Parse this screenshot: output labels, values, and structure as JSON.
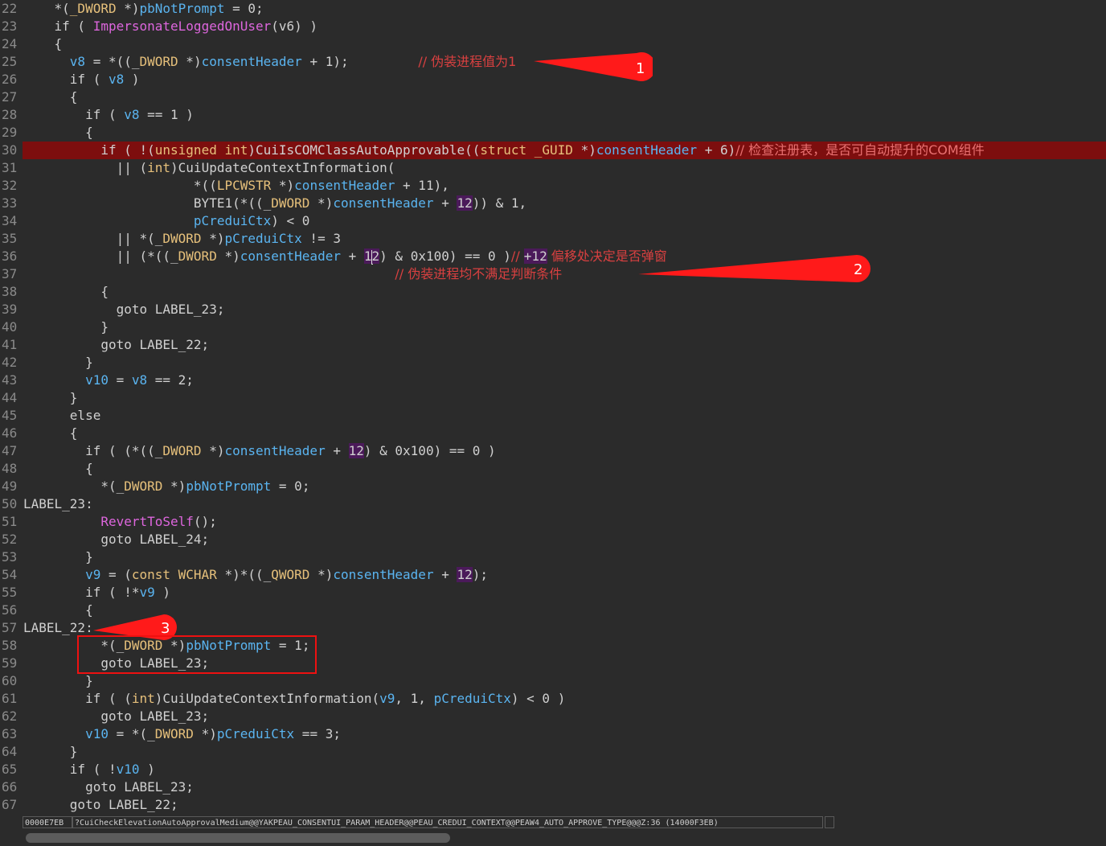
{
  "editor": {
    "lines": [
      {
        "n": "22",
        "segs": [
          [
            "p",
            "    *("
          ],
          [
            "ty",
            "_DWORD"
          ],
          [
            "p",
            " *)"
          ],
          [
            "var",
            "pbNotPrompt"
          ],
          [
            "p",
            " = 0;"
          ]
        ]
      },
      {
        "n": "23",
        "segs": [
          [
            "p",
            "    if ( "
          ],
          [
            "fn",
            "ImpersonateLoggedOnUser"
          ],
          [
            "p",
            "(v6) )"
          ]
        ]
      },
      {
        "n": "24",
        "segs": [
          [
            "p",
            "    {"
          ]
        ]
      },
      {
        "n": "25",
        "segs": [
          [
            "p",
            "      "
          ],
          [
            "var",
            "v8"
          ],
          [
            "p",
            " = *((_"
          ],
          [
            "ty",
            "DWORD"
          ],
          [
            "p",
            " *)"
          ],
          [
            "var",
            "consentHeader"
          ],
          [
            "p",
            " + 1);         "
          ],
          [
            "cm",
            "// 伪装进程值为1"
          ]
        ]
      },
      {
        "n": "26",
        "segs": [
          [
            "p",
            "      if ( "
          ],
          [
            "var",
            "v8"
          ],
          [
            "p",
            " )"
          ]
        ]
      },
      {
        "n": "27",
        "segs": [
          [
            "p",
            "      {"
          ]
        ]
      },
      {
        "n": "28",
        "segs": [
          [
            "p",
            "        if ( "
          ],
          [
            "var",
            "v8"
          ],
          [
            "p",
            " == 1 )"
          ]
        ]
      },
      {
        "n": "29",
        "segs": [
          [
            "p",
            "        {"
          ]
        ]
      },
      {
        "n": "30",
        "hl": true,
        "segs": [
          [
            "p",
            "          if ( !("
          ],
          [
            "ty",
            "unsigned int"
          ],
          [
            "p",
            ")CuiIsCOMClassAutoApprovable(("
          ],
          [
            "ty",
            "struct _GUID"
          ],
          [
            "p",
            " *)"
          ],
          [
            "var",
            "consentHeader"
          ],
          [
            "p",
            " + 6)"
          ],
          [
            "cm",
            "// 检查注册表，是否可自动提升的COM组件"
          ]
        ]
      },
      {
        "n": "31",
        "segs": [
          [
            "p",
            "            || ("
          ],
          [
            "ty",
            "int"
          ],
          [
            "p",
            ")CuiUpdateContextInformation("
          ]
        ]
      },
      {
        "n": "32",
        "segs": [
          [
            "p",
            "                      *(("
          ],
          [
            "ty",
            "LPCWSTR"
          ],
          [
            "p",
            " *)"
          ],
          [
            "var",
            "consentHeader"
          ],
          [
            "p",
            " + 11),"
          ]
        ]
      },
      {
        "n": "33",
        "segs": [
          [
            "p",
            "                      BYTE1(*((_"
          ],
          [
            "ty",
            "DWORD"
          ],
          [
            "p",
            " *)"
          ],
          [
            "var",
            "consentHeader"
          ],
          [
            "p",
            " + "
          ],
          [
            "num",
            "12"
          ],
          [
            "p",
            ")) & 1,"
          ]
        ]
      },
      {
        "n": "34",
        "segs": [
          [
            "p",
            "                      "
          ],
          [
            "var",
            "pCreduiCtx"
          ],
          [
            "p",
            ") < 0"
          ]
        ]
      },
      {
        "n": "35",
        "segs": [
          [
            "p",
            "            || *(_"
          ],
          [
            "ty",
            "DWORD"
          ],
          [
            "p",
            " *)"
          ],
          [
            "var",
            "pCreduiCtx"
          ],
          [
            "p",
            " != 3"
          ]
        ]
      },
      {
        "n": "36",
        "segs": [
          [
            "p",
            "            || (*((_"
          ],
          [
            "ty",
            "DWORD"
          ],
          [
            "p",
            " *)"
          ],
          [
            "var",
            "consentHeader"
          ],
          [
            "p",
            " + "
          ],
          [
            "num",
            "1"
          ],
          [
            "caret",
            ""
          ],
          [
            "num",
            "2"
          ],
          [
            "p",
            ") & 0x100) == 0 )"
          ],
          [
            "cm",
            "// "
          ],
          [
            "num",
            "+12"
          ],
          [
            "cm",
            " 偏移处决定是否弹窗"
          ]
        ]
      },
      {
        "n": "37",
        "segs": [
          [
            "p",
            "                                                "
          ],
          [
            "cm",
            "// 伪装进程均不满足判断条件"
          ]
        ]
      },
      {
        "n": "38",
        "segs": [
          [
            "p",
            "          {"
          ]
        ]
      },
      {
        "n": "39",
        "segs": [
          [
            "p",
            "            goto LABEL_23;"
          ]
        ]
      },
      {
        "n": "40",
        "segs": [
          [
            "p",
            "          }"
          ]
        ]
      },
      {
        "n": "41",
        "segs": [
          [
            "p",
            "          goto LABEL_22;"
          ]
        ]
      },
      {
        "n": "42",
        "segs": [
          [
            "p",
            "        }"
          ]
        ]
      },
      {
        "n": "43",
        "segs": [
          [
            "p",
            "        "
          ],
          [
            "var",
            "v10"
          ],
          [
            "p",
            " = "
          ],
          [
            "var",
            "v8"
          ],
          [
            "p",
            " == 2;"
          ]
        ]
      },
      {
        "n": "44",
        "segs": [
          [
            "p",
            "      }"
          ]
        ]
      },
      {
        "n": "45",
        "segs": [
          [
            "p",
            "      else"
          ]
        ]
      },
      {
        "n": "46",
        "segs": [
          [
            "p",
            "      {"
          ]
        ]
      },
      {
        "n": "47",
        "segs": [
          [
            "p",
            "        if ( (*((_"
          ],
          [
            "ty",
            "DWORD"
          ],
          [
            "p",
            " *)"
          ],
          [
            "var",
            "consentHeader"
          ],
          [
            "p",
            " + "
          ],
          [
            "num",
            "12"
          ],
          [
            "p",
            ") & 0x100) == 0 )"
          ]
        ]
      },
      {
        "n": "48",
        "segs": [
          [
            "p",
            "        {"
          ]
        ]
      },
      {
        "n": "49",
        "segs": [
          [
            "p",
            "          *(_"
          ],
          [
            "ty",
            "DWORD"
          ],
          [
            "p",
            " *)"
          ],
          [
            "var",
            "pbNotPrompt"
          ],
          [
            "p",
            " = 0;"
          ]
        ]
      },
      {
        "n": "50",
        "segs": [
          [
            "p",
            "LABEL_23:"
          ]
        ]
      },
      {
        "n": "51",
        "segs": [
          [
            "p",
            "          "
          ],
          [
            "fn",
            "RevertToSelf"
          ],
          [
            "p",
            "();"
          ]
        ]
      },
      {
        "n": "52",
        "segs": [
          [
            "p",
            "          goto LABEL_24;"
          ]
        ]
      },
      {
        "n": "53",
        "segs": [
          [
            "p",
            "        }"
          ]
        ]
      },
      {
        "n": "54",
        "segs": [
          [
            "p",
            "        "
          ],
          [
            "var",
            "v9"
          ],
          [
            "p",
            " = ("
          ],
          [
            "ty",
            "const WCHAR"
          ],
          [
            "p",
            " *)*((_"
          ],
          [
            "ty",
            "QWORD"
          ],
          [
            "p",
            " *)"
          ],
          [
            "var",
            "consentHeader"
          ],
          [
            "p",
            " + "
          ],
          [
            "num",
            "12"
          ],
          [
            "p",
            ");"
          ]
        ]
      },
      {
        "n": "55",
        "segs": [
          [
            "p",
            "        if ( !*"
          ],
          [
            "var",
            "v9"
          ],
          [
            "p",
            " )"
          ]
        ]
      },
      {
        "n": "56",
        "segs": [
          [
            "p",
            "        {"
          ]
        ]
      },
      {
        "n": "57",
        "segs": [
          [
            "p",
            "LABEL_22:"
          ]
        ]
      },
      {
        "n": "58",
        "segs": [
          [
            "p",
            "          *(_"
          ],
          [
            "ty",
            "DWORD"
          ],
          [
            "p",
            " *)"
          ],
          [
            "var",
            "pbNotPrompt"
          ],
          [
            "p",
            " = 1;"
          ]
        ]
      },
      {
        "n": "59",
        "segs": [
          [
            "p",
            "          goto LABEL_23;"
          ]
        ]
      },
      {
        "n": "60",
        "segs": [
          [
            "p",
            "        }"
          ]
        ]
      },
      {
        "n": "61",
        "segs": [
          [
            "p",
            "        if ( ("
          ],
          [
            "ty",
            "int"
          ],
          [
            "p",
            ")CuiUpdateContextInformation("
          ],
          [
            "var",
            "v9"
          ],
          [
            "p",
            ", 1, "
          ],
          [
            "var",
            "pCreduiCtx"
          ],
          [
            "p",
            ") < 0 )"
          ]
        ]
      },
      {
        "n": "62",
        "segs": [
          [
            "p",
            "          goto LABEL_23;"
          ]
        ]
      },
      {
        "n": "63",
        "segs": [
          [
            "p",
            "        "
          ],
          [
            "var",
            "v10"
          ],
          [
            "p",
            " = *(_"
          ],
          [
            "ty",
            "DWORD"
          ],
          [
            "p",
            " *)"
          ],
          [
            "var",
            "pCreduiCtx"
          ],
          [
            "p",
            " == 3;"
          ]
        ]
      },
      {
        "n": "64",
        "segs": [
          [
            "p",
            "      }"
          ]
        ]
      },
      {
        "n": "65",
        "segs": [
          [
            "p",
            "      if ( !"
          ],
          [
            "var",
            "v10"
          ],
          [
            "p",
            " )"
          ]
        ]
      },
      {
        "n": "66",
        "segs": [
          [
            "p",
            "        goto LABEL_23;"
          ]
        ]
      },
      {
        "n": "67",
        "segs": [
          [
            "p",
            "      goto LABEL_22;"
          ]
        ]
      }
    ]
  },
  "annotations": {
    "callout1": "1",
    "callout2": "2",
    "callout3": "3"
  },
  "statusbar": {
    "address": "0000E7EB",
    "location": "?CuiCheckElevationAutoApprovalMedium@@YAKPEAU_CONSENTUI_PARAM_HEADER@@PEAU_CREDUI_CONTEXT@@PEAW4_AUTO_APPROVE_TYPE@@@Z:36 (14000F3EB)",
    "extra": ""
  },
  "colors": {
    "background": "#2b2b2b",
    "highlight_line": "#7b0f0f",
    "comment": "#d94040",
    "variable": "#5ab4f0",
    "type": "#e6c07b",
    "function": "#dd66dd",
    "callout": "#ff1a1a"
  }
}
